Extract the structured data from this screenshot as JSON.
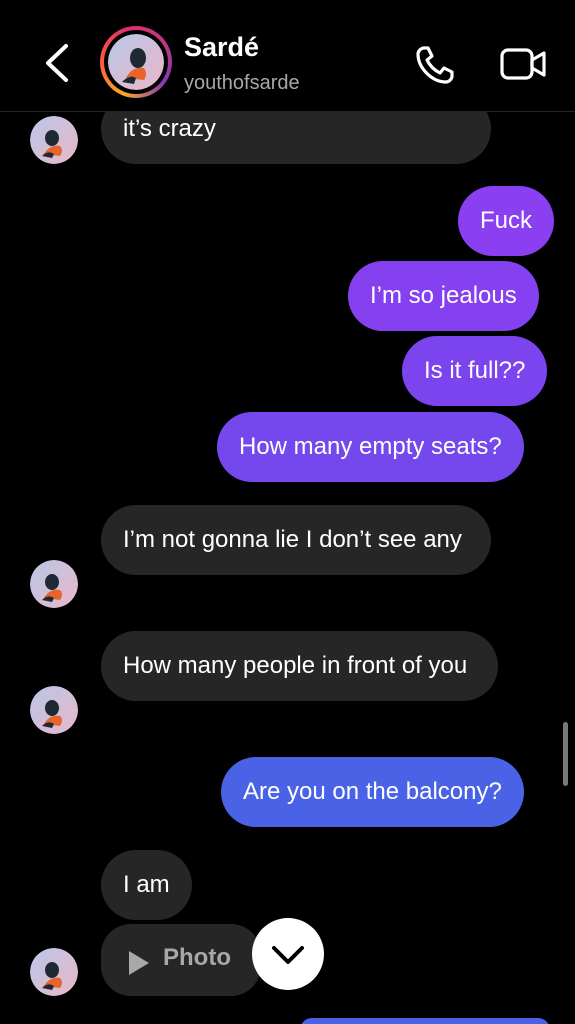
{
  "header": {
    "name": "Sardé",
    "handle": "youthofsarde",
    "icons": [
      "back-chevron-icon",
      "phone-icon",
      "video-camera-icon"
    ]
  },
  "messages": [
    {
      "id": "m1",
      "sender": "them",
      "text": "it’s crazy"
    },
    {
      "id": "m2",
      "sender": "me",
      "text": "Fuck"
    },
    {
      "id": "m3",
      "sender": "me",
      "text": "I’m so jealous"
    },
    {
      "id": "m4",
      "sender": "me",
      "text": "Is it full??"
    },
    {
      "id": "m5",
      "sender": "me",
      "text": "How many empty seats?"
    },
    {
      "id": "m6",
      "sender": "them",
      "text": "I’m not gonna lie I don’t see any"
    },
    {
      "id": "m7",
      "sender": "them",
      "text": "How many people in front of you"
    },
    {
      "id": "m8",
      "sender": "me",
      "text": "Are you on the balcony?"
    },
    {
      "id": "m9",
      "sender": "them",
      "text": "I am"
    },
    {
      "id": "m10",
      "sender": "them",
      "type": "photo",
      "text": "Photo"
    }
  ],
  "colors": {
    "outgoing_purple": "#8a3ff0",
    "outgoing_blue": "#4a63e6",
    "incoming": "#262626",
    "background": "#000000",
    "secondary_text": "#a8a8a8"
  }
}
